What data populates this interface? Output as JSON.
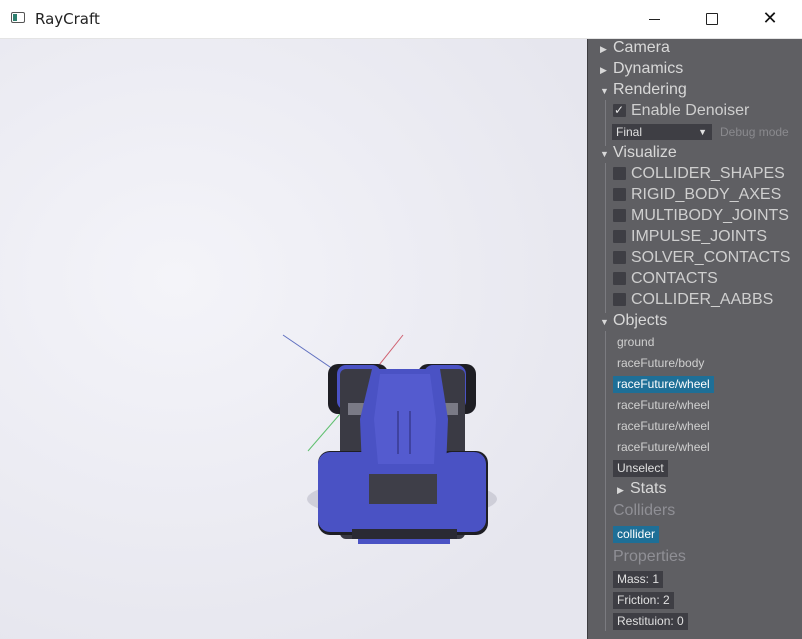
{
  "window": {
    "title": "RayCraft",
    "icon": "app-window-icon",
    "controls": {
      "minimize": "minimize-icon",
      "maximize": "maximize-icon",
      "close": "close-icon"
    },
    "close_glyph": "✕"
  },
  "panel": {
    "camera": {
      "label": "Camera",
      "expanded": false
    },
    "dynamics": {
      "label": "Dynamics",
      "expanded": false
    },
    "rendering": {
      "label": "Rendering",
      "expanded": true,
      "enable_denoiser": {
        "label": "Enable Denoiser",
        "checked": true
      },
      "debug_mode": {
        "value": "Final",
        "label": "Debug mode"
      }
    },
    "visualize": {
      "label": "Visualize",
      "expanded": true,
      "options": [
        {
          "label": "COLLIDER_SHAPES",
          "checked": false
        },
        {
          "label": "RIGID_BODY_AXES",
          "checked": false
        },
        {
          "label": "MULTIBODY_JOINTS",
          "checked": false
        },
        {
          "label": "IMPULSE_JOINTS",
          "checked": false
        },
        {
          "label": "SOLVER_CONTACTS",
          "checked": false
        },
        {
          "label": "CONTACTS",
          "checked": false
        },
        {
          "label": "COLLIDER_AABBS",
          "checked": false
        }
      ]
    },
    "objects": {
      "label": "Objects",
      "expanded": true,
      "items": [
        {
          "label": "ground",
          "selected": false
        },
        {
          "label": "raceFuture/body",
          "selected": false
        },
        {
          "label": "raceFuture/wheel",
          "selected": true
        },
        {
          "label": "raceFuture/wheel",
          "selected": false
        },
        {
          "label": "raceFuture/wheel",
          "selected": false
        },
        {
          "label": "raceFuture/wheel",
          "selected": false
        }
      ],
      "unselect": "Unselect",
      "stats": {
        "label": "Stats",
        "expanded": false
      },
      "colliders_heading": "Colliders",
      "collider": "collider",
      "properties_heading": "Properties",
      "properties": {
        "mass": "Mass: 1",
        "friction": "Friction: 2",
        "restitution": "Restituion: 0"
      }
    }
  },
  "colors": {
    "panel_bg": "#5f5f63",
    "selected": "#1e6f97",
    "car_body": "#4a52c4",
    "tire": "#1e1e24"
  }
}
